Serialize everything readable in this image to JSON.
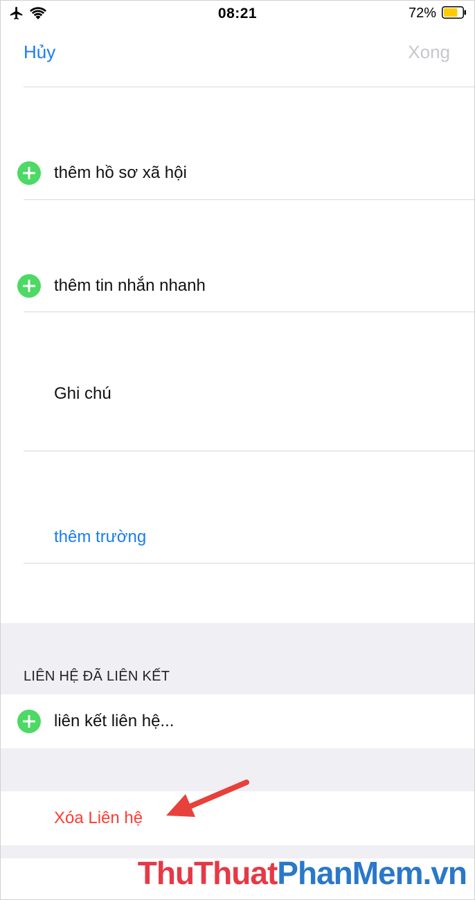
{
  "status_bar": {
    "time": "08:21",
    "battery_percent": "72%",
    "battery_level": 0.72,
    "battery_color": "#ffcc00"
  },
  "nav": {
    "cancel_label": "Hủy",
    "done_label": "Xong"
  },
  "rows": {
    "add_social_profile": "thêm hồ sơ xã hội",
    "add_instant_message": "thêm tin nhắn nhanh",
    "notes": "Ghi chú",
    "add_field": "thêm trường"
  },
  "linked_contacts": {
    "header": "LIÊN HỆ ĐÃ LIÊN KẾT",
    "link_contact": "liên kết liên hệ..."
  },
  "delete_contact_label": "Xóa Liên hệ",
  "watermark": {
    "part1": "ThuThuat",
    "part2": "PhanMem",
    "part3": ".vn"
  },
  "colors": {
    "ios_blue": "#1a7cf2",
    "ios_green": "#4cd964",
    "ios_red": "#ff3b30",
    "group_gray": "#efeff4"
  },
  "icons": [
    "airplane-icon",
    "wifi-icon",
    "battery-icon",
    "plus-circle-icon",
    "arrow-annotation-icon"
  ]
}
